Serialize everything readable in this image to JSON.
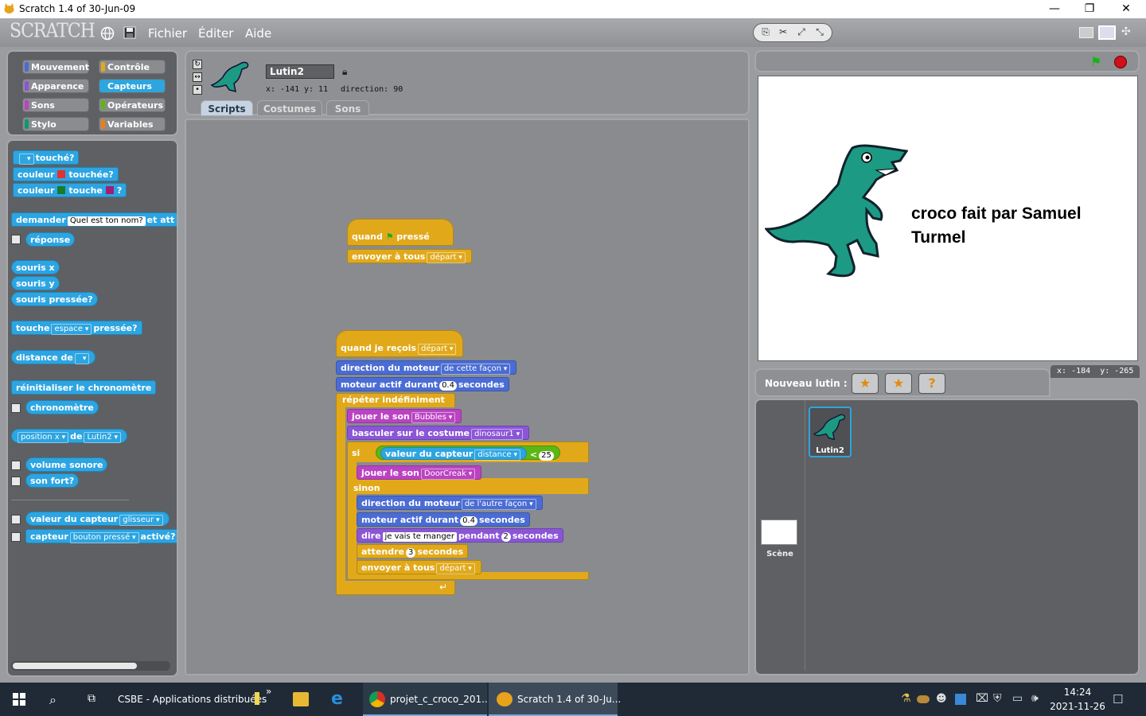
{
  "window": {
    "title": "Scratch 1.4 of 30-Jun-09",
    "controls": [
      "—",
      "❐",
      "✕"
    ]
  },
  "menubar": {
    "logo": "SCRATCH",
    "items": [
      "Fichier",
      "Éditer",
      "Aide"
    ]
  },
  "categories": [
    "Mouvement",
    "Contrôle",
    "Apparence",
    "Capteurs",
    "Sons",
    "Opérateurs",
    "Stylo",
    "Variables"
  ],
  "category_colors": [
    "#4a6cd4",
    "#e1a91a",
    "#8a55d7",
    "#2ca5e2",
    "#bb42c3",
    "#5cb712",
    "#0e9a6c",
    "#ee7d16"
  ],
  "selected_category": "Capteurs",
  "palette": {
    "touche_q": "touché?",
    "couleur": "couleur",
    "touchee_q": "touchée?",
    "touche": "touche",
    "q": "?",
    "demander": "demander",
    "demander_val": "Quel est ton nom?",
    "et_att": "et att",
    "reponse": "réponse",
    "souris_x": "souris x",
    "souris_y": "souris y",
    "souris_pressee": "souris pressée?",
    "touche_key": "touche",
    "espace": "espace",
    "pressee": "pressée?",
    "distance_de": "distance de",
    "reinit": "réinitialiser le chronomètre",
    "chrono": "chronomètre",
    "position_x": "position x",
    "de": "de",
    "lutin2": "Lutin2",
    "volume": "volume sonore",
    "son_fort": "son fort?",
    "valeur_capteur": "valeur du capteur",
    "glisseur": "glisseur",
    "capteur": "capteur",
    "bouton_presse": "bouton pressé",
    "active": "activé?"
  },
  "sprite": {
    "name": "Lutin2",
    "x_label": "x: -141",
    "y_label": "y: 11",
    "direction_label": "direction: 90"
  },
  "tabs": [
    "Scripts",
    "Costumes",
    "Sons"
  ],
  "script1": {
    "quand": "quand",
    "presse": "pressé",
    "envoyer": "envoyer à tous",
    "depart": "départ"
  },
  "script2": {
    "quand_recois": "quand je reçois",
    "depart": "départ",
    "direction_moteur": "direction du moteur",
    "cette_facon": "de cette façon",
    "moteur_actif": "moteur actif durant",
    "v04": "0.4",
    "secondes": "secondes",
    "repeter": "répéter indéfiniment",
    "jouer_son": "jouer le son",
    "bubbles": "Bubbles",
    "basculer": "basculer sur le costume",
    "dinosaur1": "dinosaur1",
    "si": "si",
    "valeur_capteur": "valeur du capteur",
    "distance": "distance",
    "lt": "<",
    "v25": "25",
    "doorcreak": "DoorCreak",
    "sinon": "sinon",
    "autre_facon": "de l'autre façon",
    "dire": "dire",
    "manger": "je vais te manger",
    "pendant": "pendant",
    "v2": "2",
    "attendre": "attendre",
    "v3": "3",
    "envoyer": "envoyer à tous"
  },
  "stage": {
    "text": "croco fait par Samuel Turmel",
    "coords_x": "x: -184",
    "coords_y": "y: -265"
  },
  "sprite_list": {
    "label": "Nouveau lutin :",
    "sprite": "Lutin2",
    "stage": "Scène"
  },
  "taskbar": {
    "items": [
      "CSBE - Applications distribuées",
      "projet_c_croco_201...",
      "Scratch 1.4 of 30-Ju..."
    ],
    "chevron": "»",
    "time": "14:24",
    "date": "2021-11-26"
  }
}
